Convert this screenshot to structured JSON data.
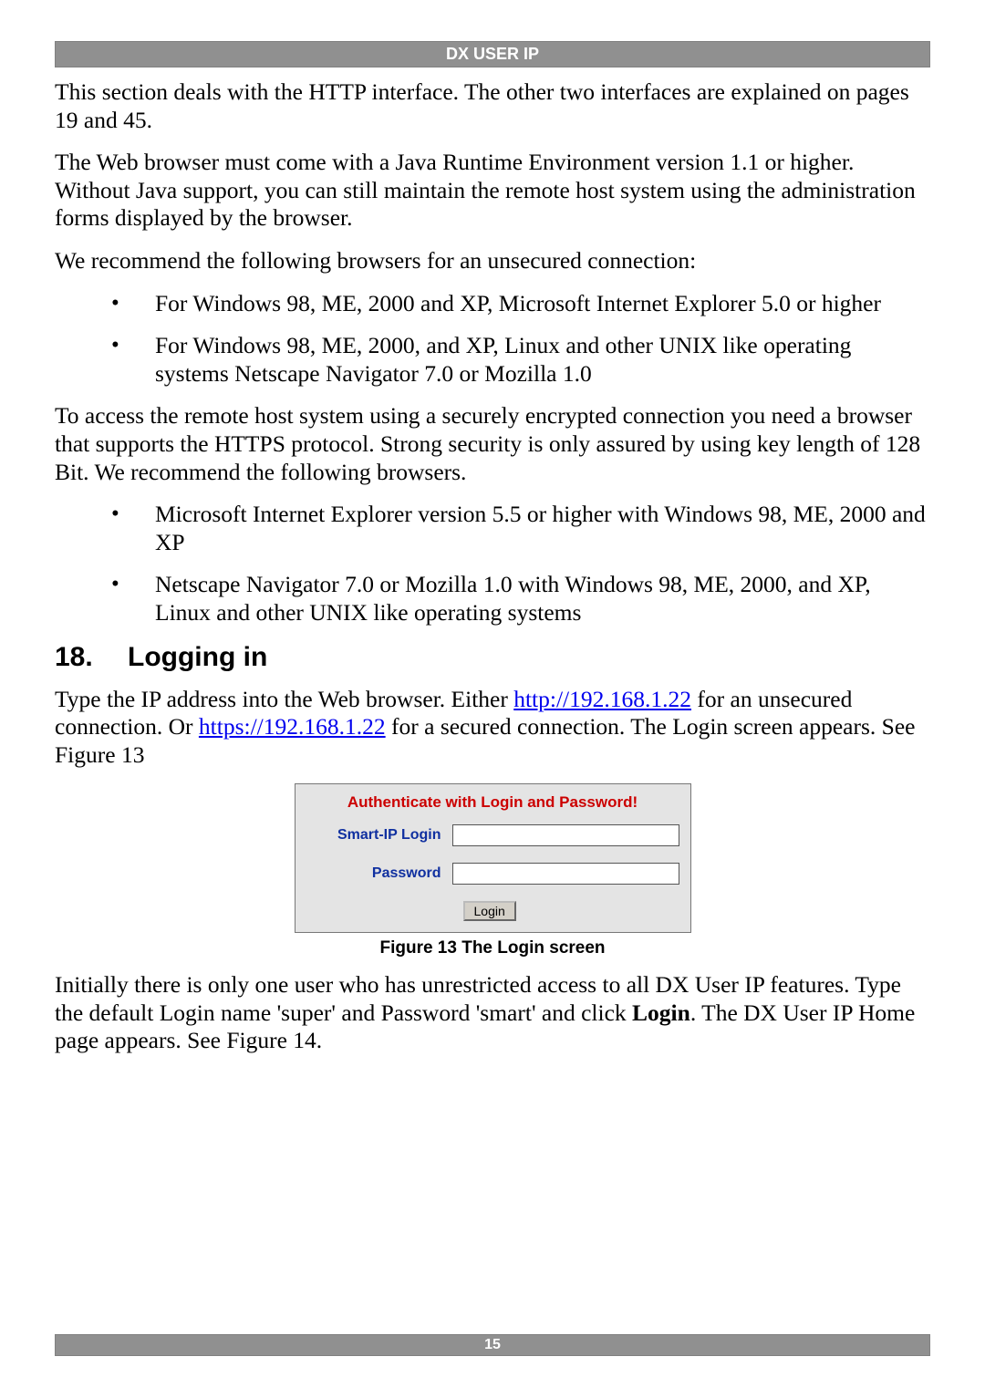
{
  "header": {
    "title": "DX USER IP"
  },
  "p1": "This section deals with the HTTP interface. The other two interfaces are explained on pages 19 and 45.",
  "p2": "The Web browser must come with a Java Runtime Environment version 1.1 or higher. Without Java support, you can still maintain the remote host system using the administration forms displayed by the browser.",
  "p3": "We recommend the following browsers for an unsecured connection:",
  "list1": {
    "item1": "For Windows 98, ME, 2000 and XP, Microsoft Internet Explorer 5.0 or higher",
    "item2": "For Windows 98, ME, 2000, and XP, Linux and other UNIX like operating systems Netscape Navigator 7.0 or Mozilla 1.0"
  },
  "p4": "To access the remote host system using a securely encrypted connection you need a browser that supports the HTTPS protocol. Strong security is only assured by using key length of 128 Bit. We recommend the following browsers.",
  "list2": {
    "item1": "Microsoft Internet Explorer version 5.5 or higher with Windows 98, ME, 2000 and XP",
    "item2": "Netscape Navigator 7.0 or Mozilla 1.0 with Windows 98, ME, 2000, and XP, Linux and other UNIX like operating systems"
  },
  "section": {
    "num": "18.",
    "title": "Logging in"
  },
  "p5": {
    "t1": "Type the IP address into the Web browser. Either ",
    "link1": "http://192.168.1.22",
    "t2": " for an unsecured connection. Or ",
    "link2": "https://192.168.1.22",
    "t3": " for a secured connection. The Login screen appears. See Figure 13"
  },
  "login": {
    "title": "Authenticate with Login and Password!",
    "loginLabel": "Smart-IP Login",
    "passwordLabel": "Password",
    "loginValue": "",
    "passwordValue": "",
    "button": "Login"
  },
  "figcaption": "Figure 13 The Login screen",
  "p6": {
    "t1": "Initially there is only one user who has unrestricted access to all DX User IP features. Type the default Login name 'super' and Password 'smart' and click ",
    "bold": "Login",
    "t2": ". The DX User IP Home page appears. See Figure 14."
  },
  "footer": {
    "pagenum": "15"
  }
}
